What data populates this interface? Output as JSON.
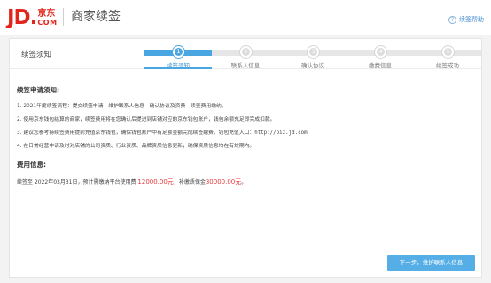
{
  "header": {
    "logo_jd": "JD.",
    "logo_cn": "京东",
    "logo_com": "COM",
    "title": "商家续签",
    "help_label": "续签帮助",
    "help_icon": "question-icon"
  },
  "panel": {
    "title": "续签须知",
    "steps": [
      {
        "num": "1",
        "label": "续签须知",
        "active": true
      },
      {
        "num": "2",
        "label": "联系人信息",
        "active": false
      },
      {
        "num": "3",
        "label": "确认协议",
        "active": false
      },
      {
        "num": "4",
        "label": "缴费信息",
        "active": false
      },
      {
        "num": "5",
        "label": "续签成功",
        "active": false
      }
    ]
  },
  "notice": {
    "title": "续签申请须知:",
    "items": [
      "1. 2021年度续签流程：提交续签申请—维护联系人信息—确认协议及资费—续签费用缴纳。",
      "2. 使用京东钱包结算的商家，续签费用将在您确认后提进到店铺对应的京东钱包账户，钱包余额充足即完成扣款。",
      "3. 建议您参考持续签费用提前充值京东钱包，确保钱包账户中有足额金额完成续签缴费。钱包充值入口：",
      "4. 在日常经营中请及时对店铺的公司资质、行业资质、品牌资质信息更新，确保资质信息均在有效期内。"
    ],
    "wallet_url": "http://biz.jd.com"
  },
  "fee": {
    "title": "费用信息:",
    "prefix": "续签至",
    "date_text": "2022年03月31日，预计需缴纳平台使用费",
    "platform_fee": "12000.00元",
    "mid_text": "，补缴质保金",
    "deposit": "30000.00元",
    "suffix": "。"
  },
  "actions": {
    "next_label": "下一步，维护联系人信息"
  },
  "colors": {
    "brand_red": "#e1251b",
    "accent_blue": "#4aa6e0",
    "amount_red": "#e4393c"
  }
}
